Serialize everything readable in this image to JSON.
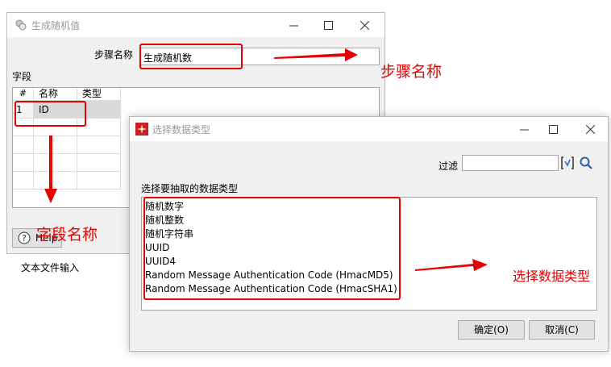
{
  "win1": {
    "title": "生成随机值",
    "step_label": "步骤名称",
    "step_value": "生成随机数",
    "fields_label": "字段",
    "table": {
      "columns": [
        "#",
        "名称",
        "类型"
      ],
      "rows": [
        [
          "1",
          "ID",
          ""
        ]
      ]
    },
    "help_label": "Help"
  },
  "desktop": {
    "bg_label": "文本文件输入"
  },
  "win2": {
    "title": "选择数据类型",
    "filter_label": "过滤",
    "filter_value": "",
    "list_label": "选择要抽取的数据类型",
    "items": [
      "随机数字",
      "随机整数",
      "随机字符串",
      "UUID",
      "UUID4",
      "Random Message Authentication Code (HmacMD5)",
      "Random Message Authentication Code (HmacSHA1)"
    ],
    "ok_label": "确定(O)",
    "cancel_label": "取消(C)"
  },
  "annotations": {
    "step_name": "步骤名称",
    "field_name": "字段名称",
    "data_type": "选择数据类型"
  },
  "colors": {
    "annotation": "#e60000",
    "window_bg": "#f0f0f0"
  }
}
